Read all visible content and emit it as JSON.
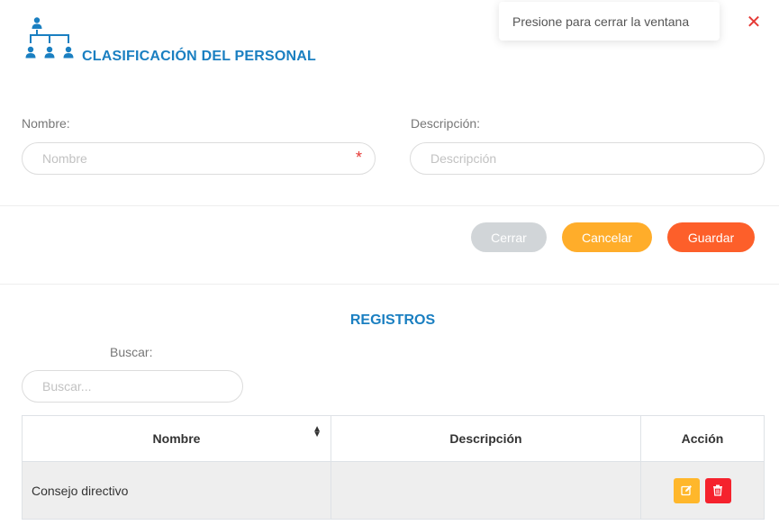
{
  "header": {
    "title": "CLASIFICACIÓN DEL PERSONAL",
    "icon": "org-chart-icon"
  },
  "tooltip": {
    "text": "Presione para cerrar la ventana",
    "close_symbol": "✕"
  },
  "form": {
    "nombre": {
      "label": "Nombre:",
      "placeholder": "Nombre",
      "value": "",
      "required_mark": "*"
    },
    "descripcion": {
      "label": "Descripción:",
      "placeholder": "Descripción",
      "value": ""
    }
  },
  "actions": {
    "cerrar": "Cerrar",
    "cancelar": "Cancelar",
    "guardar": "Guardar"
  },
  "records": {
    "title": "REGISTROS",
    "search": {
      "label": "Buscar:",
      "placeholder": "Buscar...",
      "value": ""
    },
    "columns": {
      "nombre": "Nombre",
      "descripcion": "Descripción",
      "accion": "Acción"
    },
    "rows": [
      {
        "nombre": "Consejo directivo",
        "descripcion": ""
      }
    ]
  },
  "colors": {
    "accent": "#1a7fc1",
    "cancel": "#ffad2a",
    "save": "#fd5f2a",
    "close": "#d1d5d8",
    "danger": "#f5222d",
    "edit": "#ffb72b"
  }
}
